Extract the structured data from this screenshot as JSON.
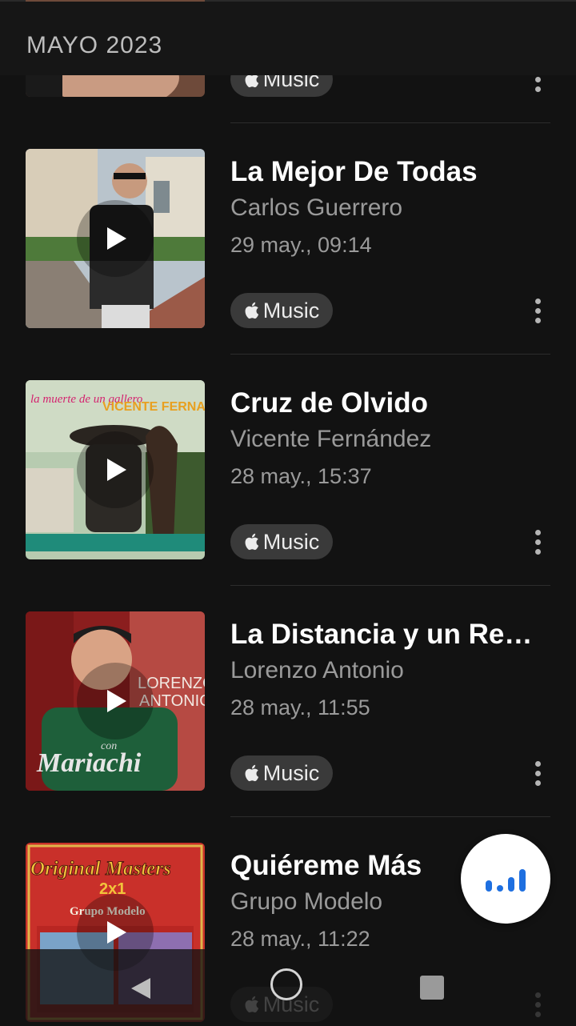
{
  "header": {
    "title": "MAYO 2023"
  },
  "badge_label": "Music",
  "items": [
    {
      "title": "",
      "artist": "",
      "date": ""
    },
    {
      "title": "La Mejor De Todas",
      "artist": "Carlos Guerrero",
      "date": "29 may., 09:14"
    },
    {
      "title": "Cruz de Olvido",
      "artist": "Vicente Fernández",
      "date": "28 may., 15:37",
      "cover_text": [
        "la muerte de un gallero",
        "VICENTE FERNANDEZ"
      ]
    },
    {
      "title": "La Distancia y un Rec…",
      "artist": "Lorenzo Antonio",
      "date": "28 may., 11:55",
      "cover_text": [
        "LORENZO",
        "ANTONIO",
        "con",
        "Mariachi"
      ]
    },
    {
      "title": "Quiéreme Más",
      "artist": "Grupo Modelo",
      "date": "28 may., 11:22",
      "cover_text": [
        "Original Masters",
        "2x1",
        "Grupo Modelo"
      ]
    }
  ],
  "colors": {
    "accent": "#1e6fe0",
    "background": "#121212",
    "pill": "#3a3a3a"
  }
}
